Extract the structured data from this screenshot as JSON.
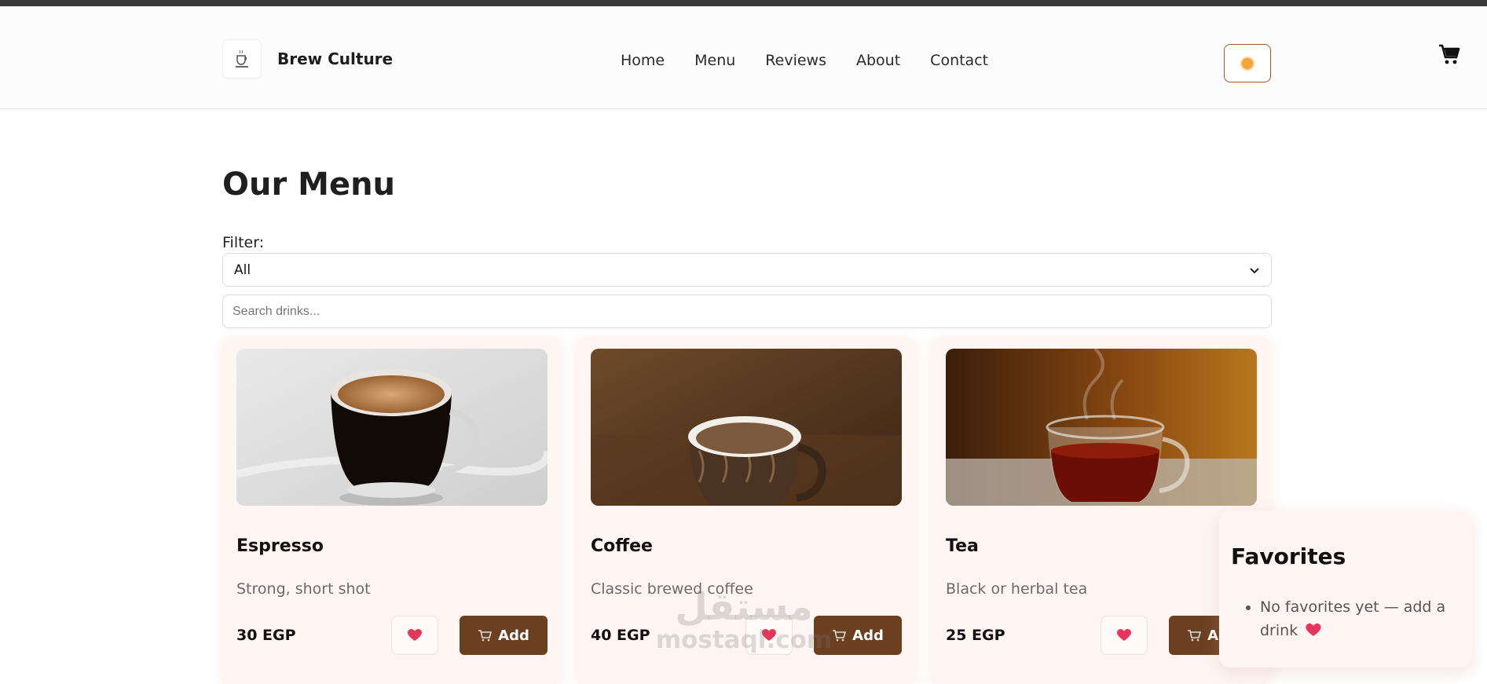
{
  "brand": {
    "name": "Brew Culture",
    "logo_text": "COFFEE"
  },
  "nav": {
    "items": [
      {
        "label": "Home"
      },
      {
        "label": "Menu"
      },
      {
        "label": "Reviews"
      },
      {
        "label": "About"
      },
      {
        "label": "Contact"
      }
    ],
    "active": "Menu"
  },
  "page": {
    "title": "Our Menu",
    "filter_label": "Filter:",
    "filter_value": "All",
    "search_placeholder": "Search drinks..."
  },
  "products": [
    {
      "name": "Espresso",
      "description": "Strong, short shot",
      "price": "30 EGP",
      "add_label": "Add"
    },
    {
      "name": "Coffee",
      "description": "Classic brewed coffee",
      "price": "40 EGP",
      "add_label": "Add"
    },
    {
      "name": "Tea",
      "description": "Black or herbal tea",
      "price": "25 EGP",
      "add_label": "Add"
    }
  ],
  "favorites": {
    "title": "Favorites",
    "empty_text": "No favorites yet — add a drink"
  },
  "watermark": {
    "arabic": "مستقل",
    "latin": "mostaql.com"
  },
  "colors": {
    "accent_brown": "#6b4020",
    "card_bg": "#fff5f2",
    "heart": "#e8355c",
    "toggle_border": "#a0582a"
  },
  "icons": [
    "logo-icon",
    "sun-icon",
    "cart-icon",
    "chevron-down-icon",
    "heart-icon"
  ]
}
